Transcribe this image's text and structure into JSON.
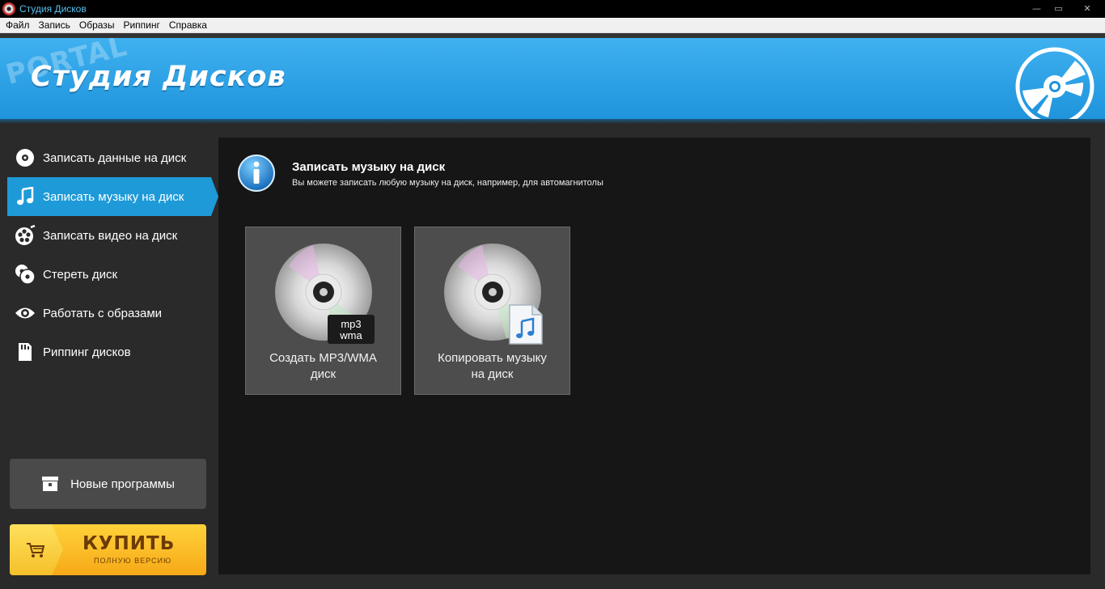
{
  "window": {
    "title": "Студия Дисков",
    "controls": {
      "minimize": "—",
      "maximize": "▭",
      "close": "✕"
    }
  },
  "menu": [
    "Файл",
    "Запись",
    "Образы",
    "Риппинг",
    "Справка"
  ],
  "header": {
    "title": "Студия Дисков",
    "watermark": "PORTAL"
  },
  "sidebar": {
    "items": [
      {
        "label": "Записать данные на диск",
        "icon": "disc-icon",
        "active": false
      },
      {
        "label": "Записать музыку на диск",
        "icon": "music-note-icon",
        "active": true
      },
      {
        "label": "Записать видео на диск",
        "icon": "film-reel-icon",
        "active": false
      },
      {
        "label": "Стереть диск",
        "icon": "erase-discs-icon",
        "active": false
      },
      {
        "label": "Работать с образами",
        "icon": "eye-icon",
        "active": false
      },
      {
        "label": "Риппинг дисков",
        "icon": "sd-card-icon",
        "active": false
      }
    ],
    "new_programs": "Новые программы",
    "buy": {
      "main": "КУПИТЬ",
      "sub": "ПОЛНУЮ ВЕРСИЮ"
    }
  },
  "main": {
    "title": "Записать музыку на диск",
    "subtitle": "Вы можете записать любую музыку на диск, например, для автомагнитолы",
    "tiles": [
      {
        "label": "Создать MP3/WMA\nдиск",
        "badge_line1": "mp3",
        "badge_line2": "wma"
      },
      {
        "label": "Копировать музыку\nна диск"
      }
    ]
  },
  "colors": {
    "accent": "#1e9ad8",
    "banner": "#3fb1f0",
    "buy": "#f7a917",
    "panel": "#161616",
    "sidebar": "#2a2a2a"
  }
}
